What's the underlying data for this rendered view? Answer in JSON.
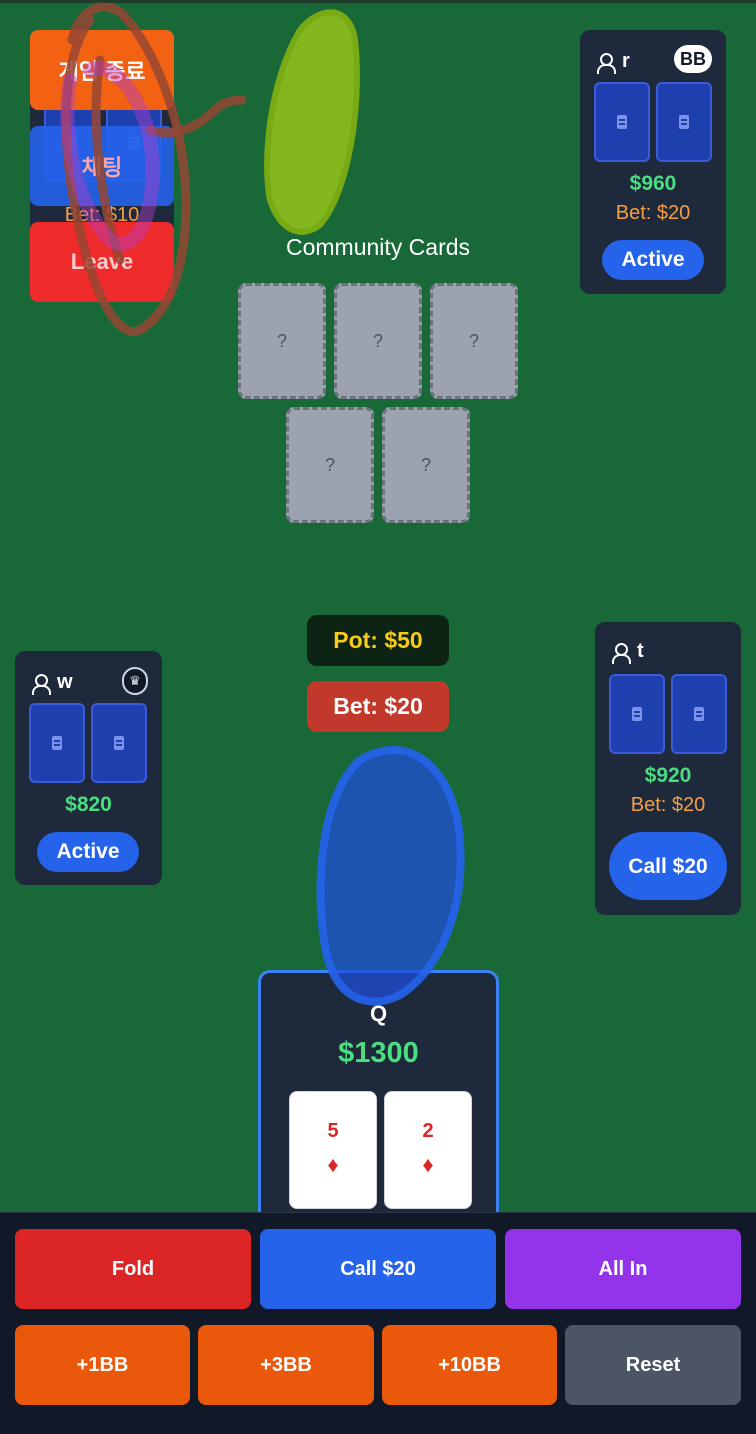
{
  "top_buttons": {
    "end_game": "게임 종료",
    "chat": "채팅",
    "leave": "Leave",
    "hidden_bet": "Bet: $10"
  },
  "players": {
    "r": {
      "name": "r",
      "badge": "BB",
      "chips": "$960",
      "bet": "Bet: $20",
      "status": "Active"
    },
    "w": {
      "name": "w",
      "badge_icon": "crown-icon",
      "chips": "$820",
      "status": "Active"
    },
    "t": {
      "name": "t",
      "chips": "$920",
      "bet": "Bet: $20",
      "status": "Call $20"
    }
  },
  "community": {
    "title": "Community Cards",
    "cards": [
      "?",
      "?",
      "?",
      "?",
      "?"
    ]
  },
  "pot": "Pot: $50",
  "current_bet": "Bet: $20",
  "hero": {
    "name": "Q",
    "chips": "$1300",
    "cards": [
      {
        "rank": "5",
        "suit": "♦"
      },
      {
        "rank": "2",
        "suit": "♦"
      }
    ]
  },
  "actions": {
    "fold": "Fold",
    "call": "Call $20",
    "all_in": "All In",
    "plus_1bb": "+1BB",
    "plus_3bb": "+3BB",
    "plus_10bb": "+10BB",
    "reset": "Reset"
  },
  "colors": {
    "table": "#186838",
    "panel": "#1e293b",
    "fold": "#dc2626",
    "call": "#2563eb",
    "all_in": "#9333ea",
    "raise": "#ea580c",
    "reset": "#4b5563",
    "chips": "#4ade80",
    "pot_text": "#facc15"
  }
}
